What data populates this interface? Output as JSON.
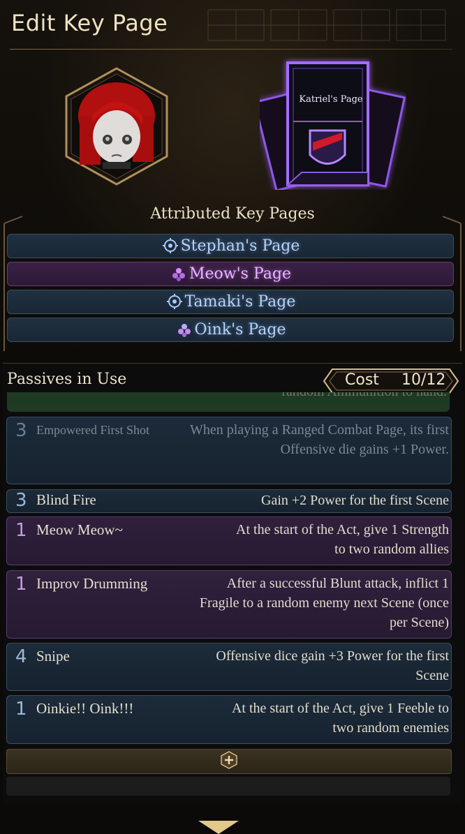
{
  "header": {
    "title": "Edit Key Page"
  },
  "key_page": {
    "title": "Katriel's Page"
  },
  "attributed": {
    "title": "Attributed Key Pages",
    "items": [
      {
        "label": "Stephan's Page",
        "color": "blue",
        "icon": "gear-emblem-icon"
      },
      {
        "label": "Meow's Page",
        "color": "purple",
        "icon": "flower-emblem-icon"
      },
      {
        "label": "Tamaki's Page",
        "color": "blue",
        "icon": "gear-emblem-icon"
      },
      {
        "label": "Oink's Page",
        "color": "blue",
        "icon": "flower-emblem-icon"
      }
    ]
  },
  "passives": {
    "header": "Passives in Use",
    "cost_label": "Cost",
    "cost_value": "10/12",
    "clipped_text": "random Ammunition to hand.",
    "items": [
      {
        "cost": "3",
        "name": "Empowered First Shot",
        "desc": "When playing a Ranged Combat Page, its first Offensive die gains +1 Power.",
        "color": "blue",
        "dim": true
      },
      {
        "cost": "3",
        "name": "Blind Fire",
        "desc": "Gain +2 Power for the first Scene",
        "color": "blue",
        "dim": false
      },
      {
        "cost": "1",
        "name": "Meow Meow~",
        "desc": "At the start of the Act, give 1 Strength to two random allies",
        "color": "purple",
        "dim": false
      },
      {
        "cost": "1",
        "name": "Improv Drumming",
        "desc": "After a successful Blunt attack, inflict 1 Fragile to a random enemy next Scene (once per Scene)",
        "color": "purple",
        "dim": false
      },
      {
        "cost": "4",
        "name": "Snipe",
        "desc": "Offensive dice gain +3 Power for the first Scene",
        "color": "blue",
        "dim": false
      },
      {
        "cost": "1",
        "name": "Oinkie!! Oink!!!",
        "desc": "At the start of the Act, give 1 Feeble to two random enemies",
        "color": "blue",
        "dim": false
      }
    ]
  },
  "colors": {
    "accent_gold": "#c8a86e",
    "blue_row": "#1c2b3a",
    "purple_row": "#30203d",
    "book_glow": "#9a5cff"
  }
}
